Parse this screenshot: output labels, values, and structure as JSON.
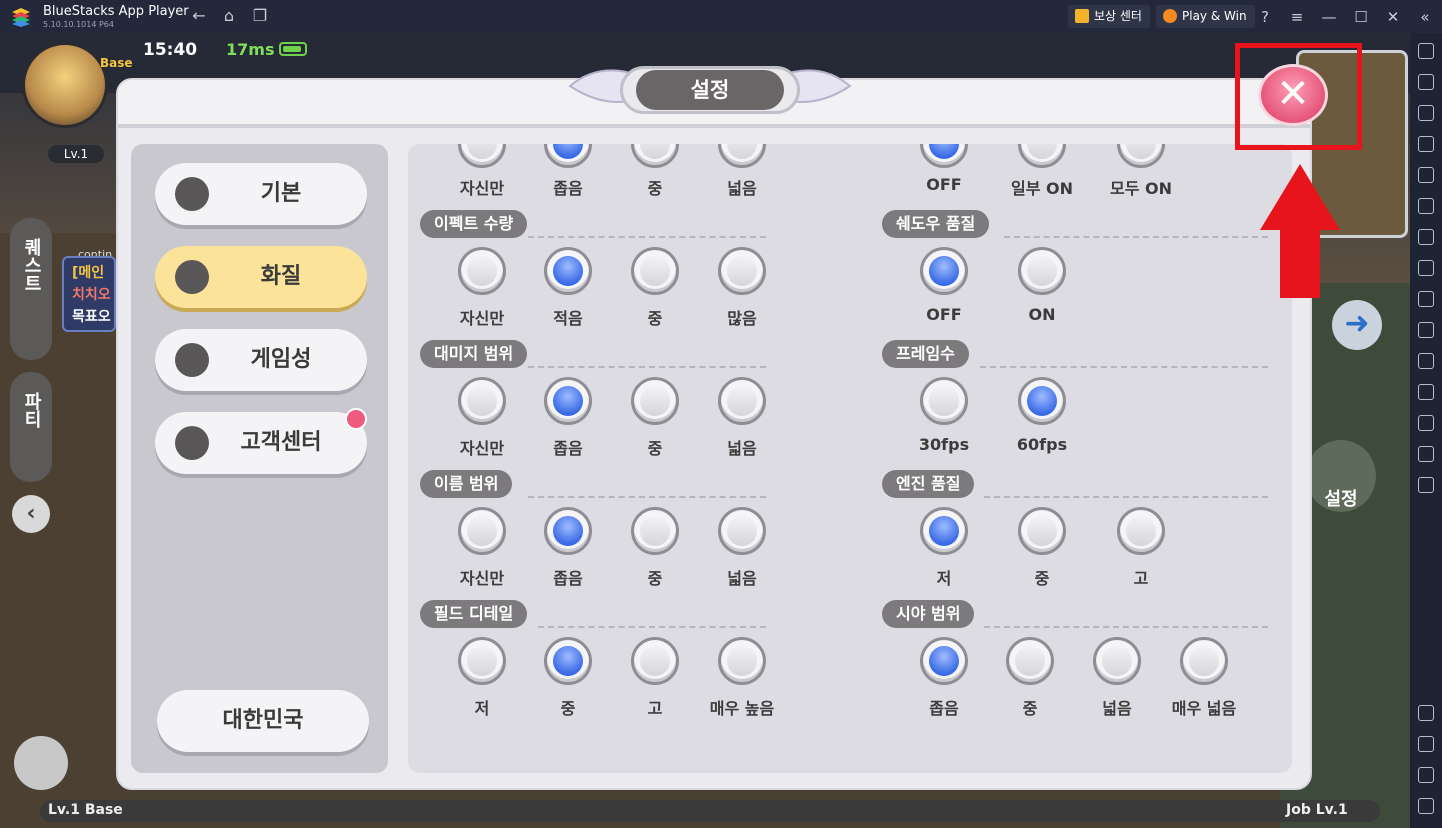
{
  "window": {
    "title": "BlueStacks App Player",
    "version": "5.10.10.1014  P64",
    "reward_center": "보상 센터",
    "play_win": "Play & Win"
  },
  "hud": {
    "time": "15:40",
    "ping": "17ms",
    "level": "Lv.1",
    "base_tag": "Base",
    "quest_tab": "퀘스트",
    "party_tab": "파티",
    "chat_lines": [
      "[메인",
      "치치오",
      "목표오"
    ],
    "chat_tag": "contin",
    "bottom_left": "Lv.1   Base",
    "bottom_right": "Job   Lv.1",
    "side_setting": "설정"
  },
  "dialog": {
    "title": "설정",
    "nav": [
      {
        "label": "기본",
        "icon": "gear-icon",
        "active": false
      },
      {
        "label": "화질",
        "icon": "monitor-icon",
        "active": true
      },
      {
        "label": "게임성",
        "icon": "gamepad-icon",
        "active": false
      },
      {
        "label": "고객센터",
        "icon": "support-icon",
        "active": false
      }
    ],
    "country": "대한민국",
    "top_row_left": [
      "자신만",
      "좁음",
      "중",
      "넓음"
    ],
    "top_row_right": [
      "OFF",
      "일부 ON",
      "모두 ON"
    ],
    "sections_left": [
      {
        "title": "이펙트 수량",
        "options": [
          "자신만",
          "적음",
          "중",
          "많음"
        ],
        "selected": 1
      },
      {
        "title": "대미지 범위",
        "options": [
          "자신만",
          "좁음",
          "중",
          "넓음"
        ],
        "selected": 1
      },
      {
        "title": "이름 범위",
        "options": [
          "자신만",
          "좁음",
          "중",
          "넓음"
        ],
        "selected": 1
      },
      {
        "title": "필드 디테일",
        "options": [
          "저",
          "중",
          "고",
          "매우 높음"
        ],
        "selected": 1
      }
    ],
    "sections_right": [
      {
        "title": "쉐도우 품질",
        "options": [
          "OFF",
          "ON"
        ],
        "selected": 0
      },
      {
        "title": "프레임수",
        "options": [
          "30fps",
          "60fps"
        ],
        "selected": 1
      },
      {
        "title": "엔진 품질",
        "options": [
          "저",
          "중",
          "고"
        ],
        "selected": 0
      },
      {
        "title": "시야 범위",
        "options": [
          "좁음",
          "중",
          "넓음",
          "매우 넓음"
        ],
        "selected": 0
      }
    ],
    "close_symbol": "✕"
  },
  "colors": {
    "annotation_red": "#e8141c",
    "radio_selected": "#3a6be6",
    "active_tab": "#fbe49a"
  }
}
